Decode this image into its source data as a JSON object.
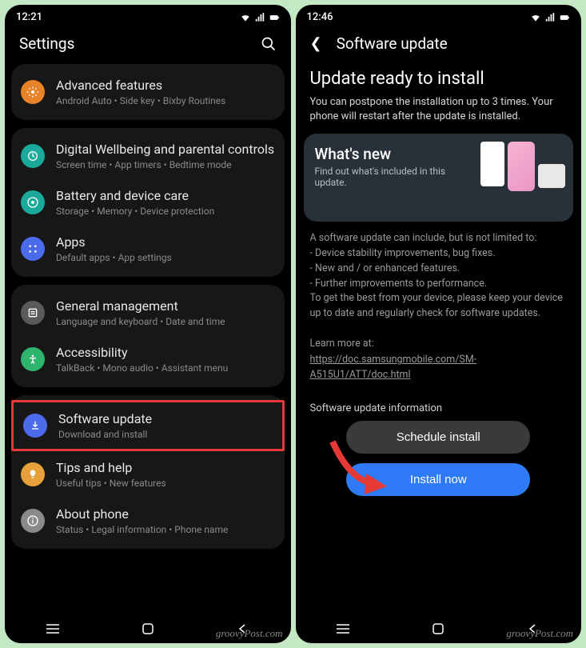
{
  "left": {
    "status": {
      "time": "12:21"
    },
    "header": {
      "title": "Settings"
    },
    "rows": {
      "advanced": {
        "title": "Advanced features",
        "sub": "Android Auto  •  Side key  •  Bixby Routines"
      },
      "wellbeing": {
        "title": "Digital Wellbeing and parental controls",
        "sub": "Screen time  •  App timers  •  Bedtime mode"
      },
      "battery": {
        "title": "Battery and device care",
        "sub": "Storage  •  Memory  •  Device protection"
      },
      "apps": {
        "title": "Apps",
        "sub": "Default apps  •  App settings"
      },
      "general": {
        "title": "General management",
        "sub": "Language and keyboard  •  Date and time"
      },
      "access": {
        "title": "Accessibility",
        "sub": "TalkBack  •  Mono audio  •  Assistant menu"
      },
      "software": {
        "title": "Software update",
        "sub": "Download and install"
      },
      "tips": {
        "title": "Tips and help",
        "sub": "Useful tips  •  New features"
      },
      "about": {
        "title": "About phone",
        "sub": "Status  •  Legal information  •  Phone name"
      }
    }
  },
  "right": {
    "status": {
      "time": "12:46"
    },
    "header": {
      "title": "Software update"
    },
    "big_title": "Update ready to install",
    "intro": "You can postpone the installation up to 3 times. Your phone will restart after the update is installed.",
    "card": {
      "title": "What's new",
      "sub": "Find out what's included in this update."
    },
    "info_lines": [
      "A software update can include, but is not limited to:",
      " - Device stability improvements, bug fixes.",
      " - New and / or enhanced features.",
      " - Further improvements to performance.",
      "To get the best from your device, please keep your device up to date and regularly check for software updates."
    ],
    "learn_label": "Learn more at:",
    "learn_link": "https://doc.samsungmobile.com/SM-A515U1/ATT/doc.html",
    "section_label": "Software update information",
    "btn_schedule": "Schedule install",
    "btn_install": "Install now"
  },
  "colors": {
    "orange": "#e8832a",
    "teal": "#1aa99a",
    "grid": "#4b6bea",
    "gray": "#5a5a5a",
    "green": "#2db56e",
    "blue": "#4b6bea",
    "amber": "#e8a13a",
    "steel": "#8a8a8a"
  },
  "watermark": "groovyPost.com"
}
